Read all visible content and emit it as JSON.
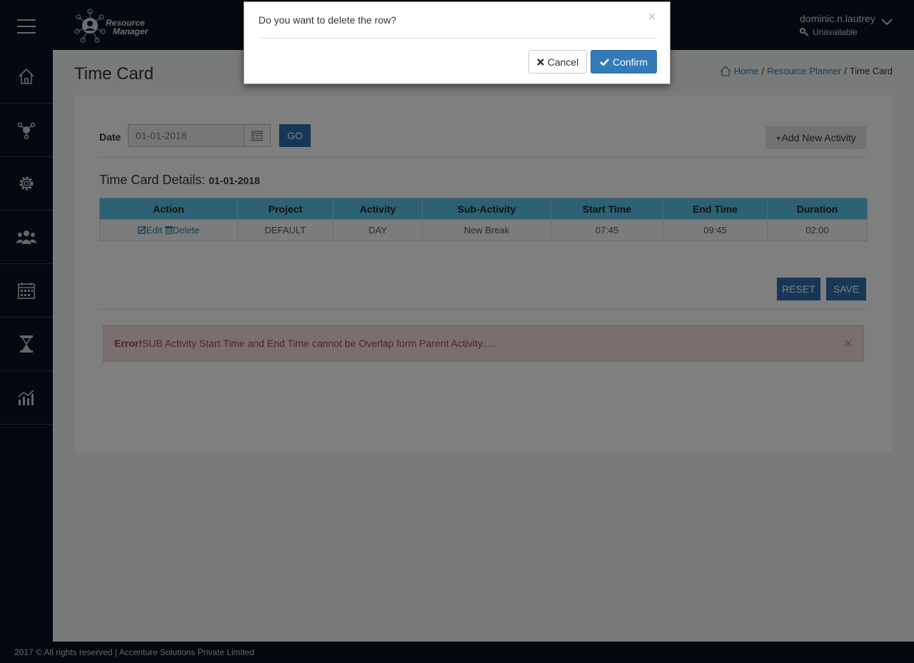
{
  "header": {
    "logo_line1": "Resource",
    "logo_line2": "Manager",
    "user_name": "dominic.n.lautrey",
    "user_status": "Unavailable"
  },
  "sidebar": {
    "items": [
      {
        "icon": "home-icon"
      },
      {
        "icon": "network-icon"
      },
      {
        "icon": "gear-icon"
      },
      {
        "icon": "team-icon"
      },
      {
        "icon": "calendar-icon"
      },
      {
        "icon": "hourglass-icon"
      },
      {
        "icon": "chart-icon"
      }
    ]
  },
  "page": {
    "title": "Time Card",
    "breadcrumb": {
      "home": "Home",
      "sep1": "/",
      "planner": "Resource Planner",
      "sep2": "/",
      "current": "Time Card"
    }
  },
  "form": {
    "date_label": "Date",
    "date_value": "01-01-2018",
    "go_label": "GO",
    "add_label": "+Add New Activity"
  },
  "details": {
    "title": "Time Card Details:",
    "date": "01-01-2018"
  },
  "table": {
    "headers": [
      "Action",
      "Project",
      "Activity",
      "Sub-Activity",
      "Start Time",
      "End Time",
      "Duration"
    ],
    "rows": [
      {
        "edit": "Edit",
        "delete": "Delete",
        "project": "DEFAULT",
        "activity": "DAY",
        "sub_activity": "New Break",
        "start": "07:45",
        "end": "09:45",
        "duration": "02:00"
      }
    ]
  },
  "actions": {
    "reset": "RESET",
    "save": "SAVE"
  },
  "alert": {
    "prefix": "Error!",
    "message": "SUB Activity Start Time and End Time cannot be Overlap form Parent Activity.....",
    "close": "×"
  },
  "modal": {
    "title": "Do you want to delete the row?",
    "close": "×",
    "cancel": "Cancel",
    "confirm": "Confirm"
  },
  "footer": {
    "text": "2017 © All rights reserved | Accenture Solutions Private Limited"
  },
  "colors": {
    "nav_bg": "#081220",
    "primary_button": "#2c6fb0",
    "table_header": "#5bc3e8",
    "alert_bg": "#f2dede",
    "alert_text": "#a94442"
  }
}
